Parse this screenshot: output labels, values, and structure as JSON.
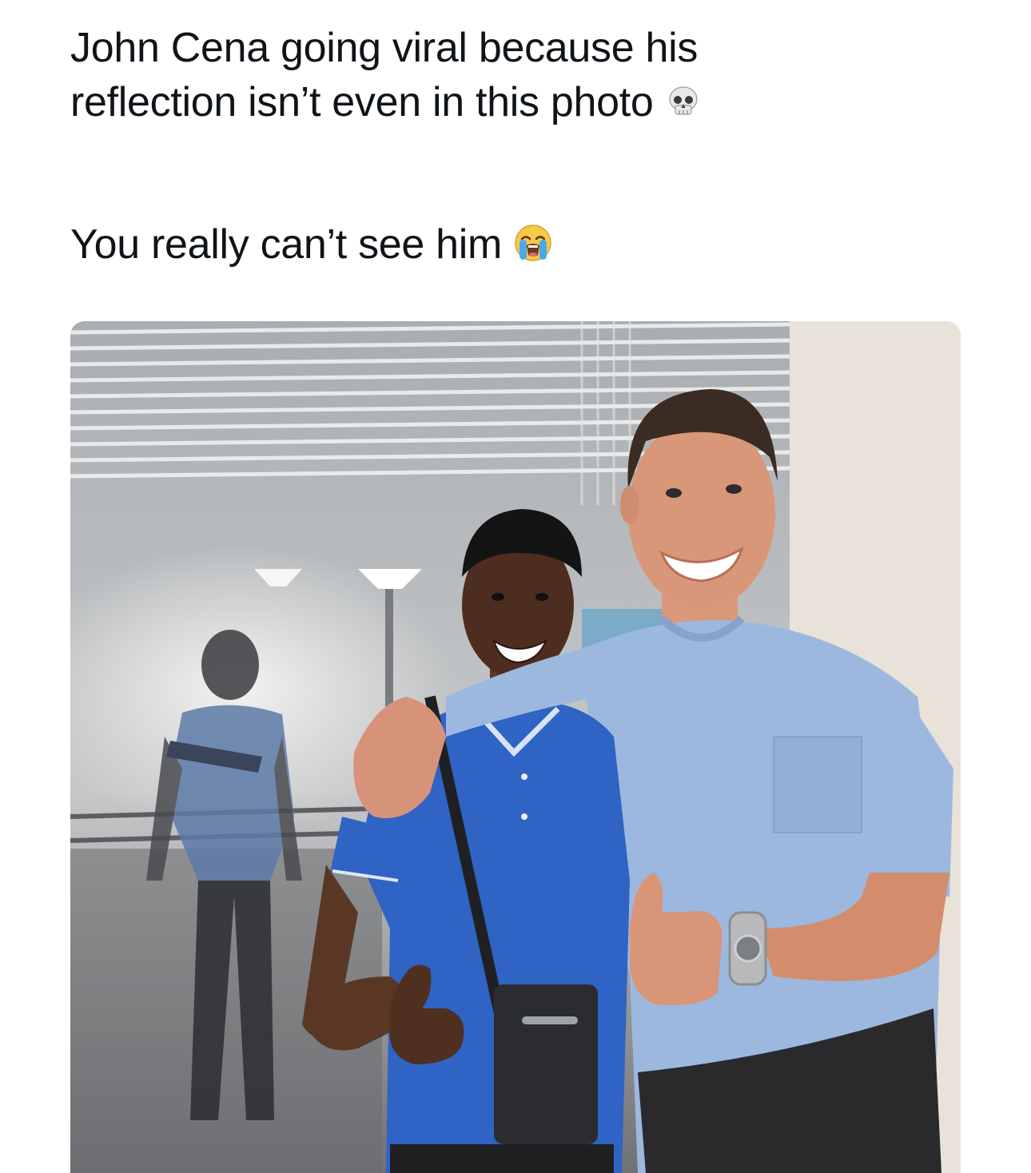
{
  "post": {
    "text_line_1": "John Cena going viral because his",
    "text_line_2": "reflection isn’t even in this photo",
    "text_line_3": "You really can’t see him",
    "emoji_1": "skull-emoji-icon",
    "emoji_2": "loudly-crying-face-emoji-icon"
  },
  "photo": {
    "subject": "two-men-posing-thumbs-up",
    "colors": {
      "left_shirt": "#2f63c4",
      "right_shirt": "#9db8df",
      "wall": "#e7e3dc",
      "window_glass": "#8a9098"
    }
  }
}
